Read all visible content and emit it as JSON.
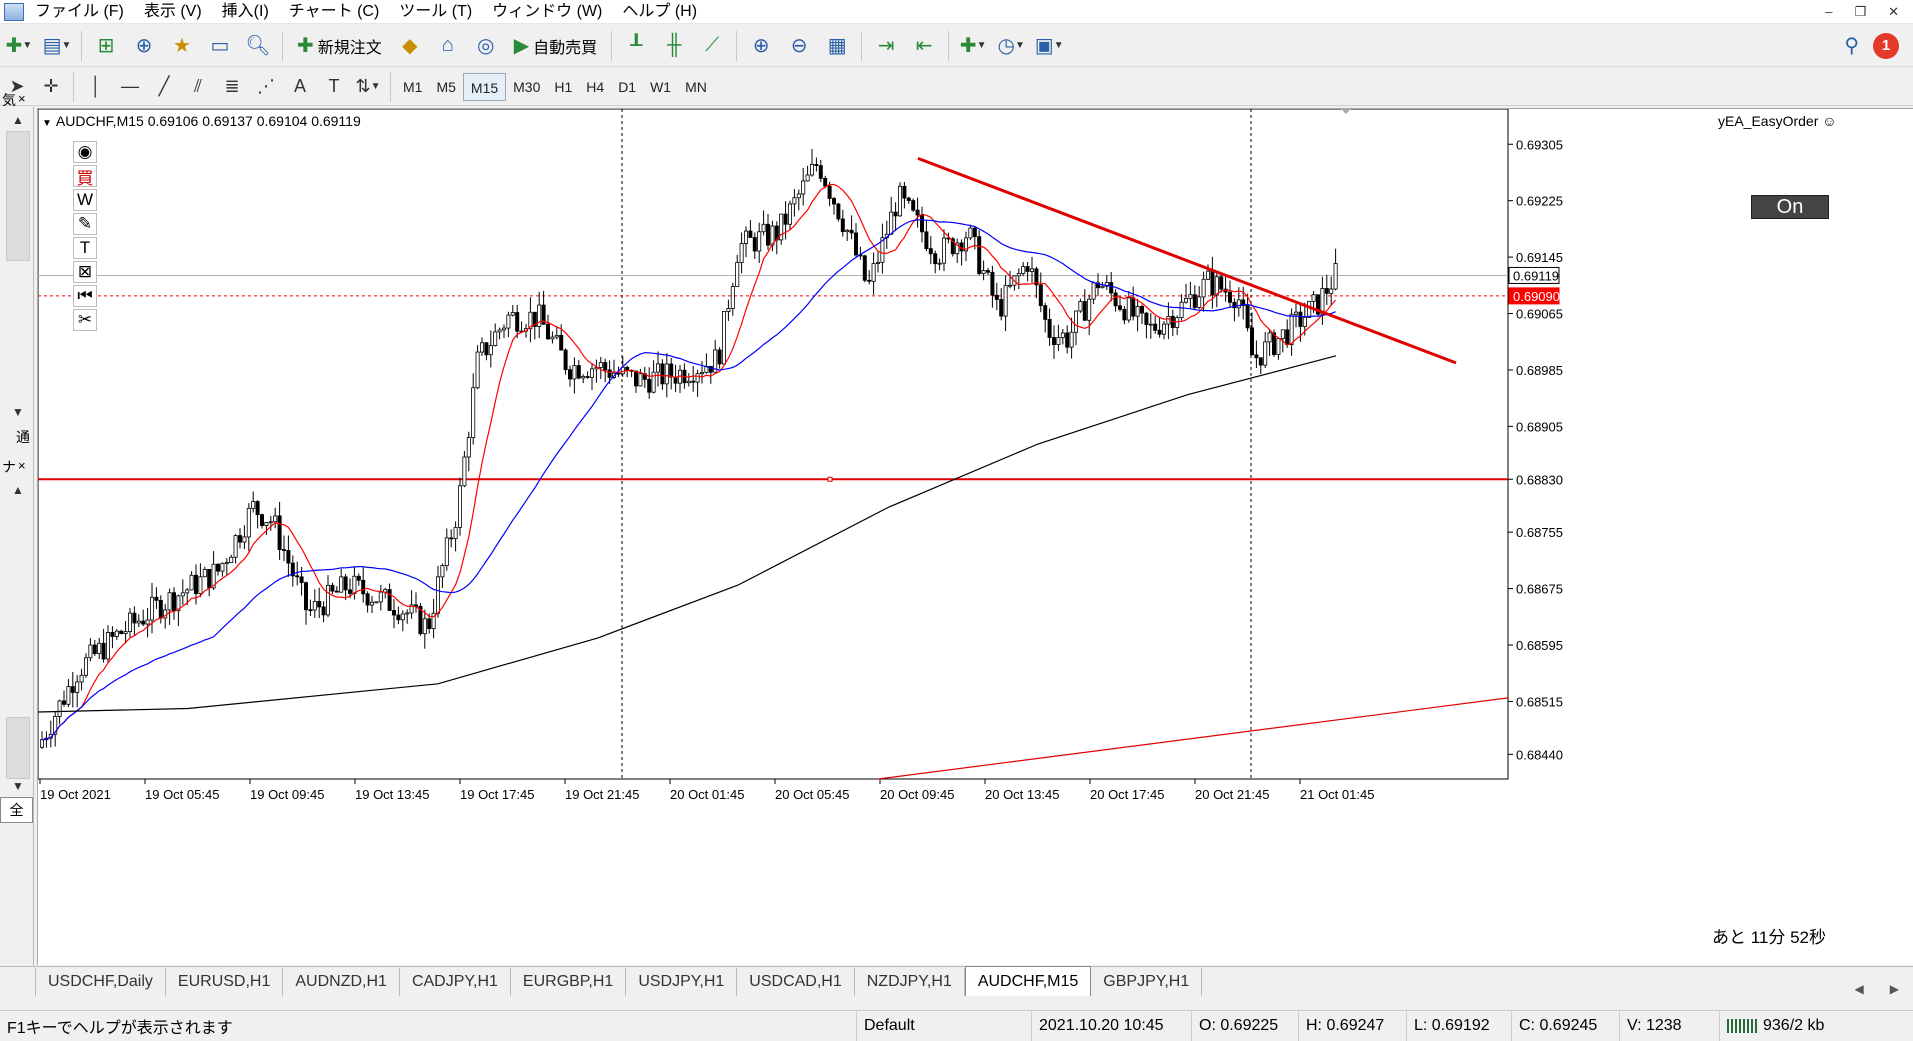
{
  "menu": [
    "ファイル (F)",
    "表示 (V)",
    "挿入(I)",
    "チャート (C)",
    "ツール (T)",
    "ウィンドウ (W)",
    "ヘルプ (H)"
  ],
  "toolbar": {
    "new_order": "新規注文",
    "auto_trade": "自動売買",
    "notification_count": "1"
  },
  "timeframes": [
    "M1",
    "M5",
    "M15",
    "M30",
    "H1",
    "H4",
    "D1",
    "W1",
    "MN"
  ],
  "active_timeframe": "M15",
  "left_panels": {
    "top_label": "通",
    "top_tab": "気",
    "bottom_tab": "ナ"
  },
  "chart": {
    "title": "AUDCHF,M15  0.69106 0.69137 0.69104 0.69119",
    "ea_name": "yEA_EasyOrder",
    "on_label": "On",
    "countdown": "あと 11分 52秒",
    "price_ticks": [
      "0.69305",
      "0.69225",
      "0.69145",
      "0.69065",
      "0.68985",
      "0.68905",
      "0.68830",
      "0.68755",
      "0.68675",
      "0.68595",
      "0.68515",
      "0.68440"
    ],
    "bid_price": "0.69119",
    "line_price": "0.69090",
    "time_ticks": [
      "19 Oct 2021",
      "19 Oct 05:45",
      "19 Oct 09:45",
      "19 Oct 13:45",
      "19 Oct 17:45",
      "19 Oct 21:45",
      "20 Oct 01:45",
      "20 Oct 05:45",
      "20 Oct 09:45",
      "20 Oct 13:45",
      "20 Oct 17:45",
      "20 Oct 21:45",
      "21 Oct 01:45"
    ],
    "colors": {
      "bull": "#ffffff",
      "bear": "#000000",
      "ma_fast": "#ff0000",
      "ma_mid": "#0000ff",
      "ma_slow": "#000000",
      "trendline": "#e00000",
      "line_label": "#ff0000"
    }
  },
  "tabs": {
    "all_label": "全",
    "items": [
      "USDCHF,Daily",
      "EURUSD,H1",
      "AUDNZD,H1",
      "CADJPY,H1",
      "EURGBP,H1",
      "USDJPY,H1",
      "USDCAD,H1",
      "NZDJPY,H1",
      "AUDCHF,M15",
      "GBPJPY,H1"
    ],
    "active": "AUDCHF,M15"
  },
  "status": {
    "help": "F1キーでヘルプが表示されます",
    "profile": "Default",
    "datetime": "2021.10.20 10:45",
    "open": "O: 0.69225",
    "high": "H: 0.69247",
    "low": "L: 0.69192",
    "close": "C: 0.69245",
    "volume": "V: 1238",
    "traffic": "936/2 kb"
  }
}
